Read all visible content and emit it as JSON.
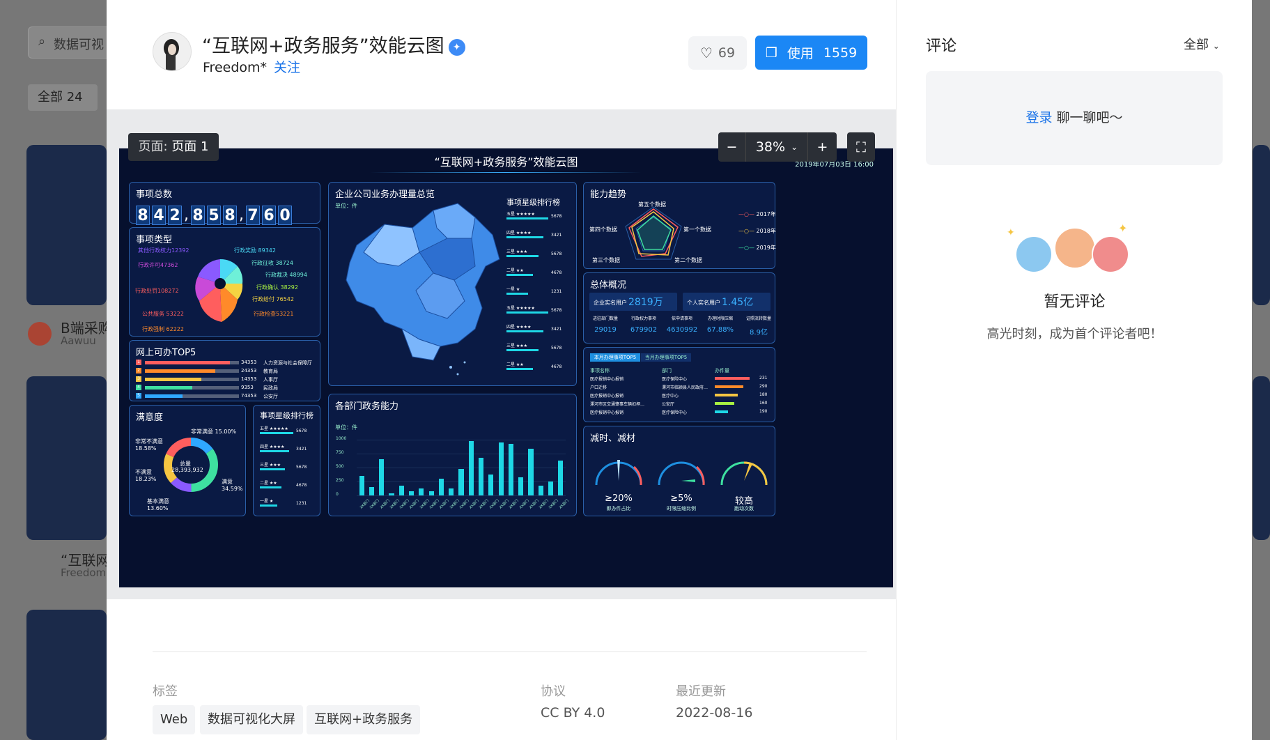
{
  "background": {
    "search_placeholder": "数据可视",
    "filter_all": "全部",
    "filter_count": "24",
    "card1_title": "B端采购",
    "card1_author": "Aawuu",
    "card2_title": "“互联网",
    "card2_author": "Freedom"
  },
  "header": {
    "title": "“互联网+政务服务”效能云图",
    "author": "Freedom*",
    "follow_label": "关注",
    "likes": "69",
    "use_label": "使用",
    "use_count": "1559"
  },
  "preview": {
    "page_prefix": "页面:",
    "page_name": "页面 1",
    "zoom_minus": "−",
    "zoom_value": "38%",
    "zoom_plus": "+"
  },
  "dashboard": {
    "title": "“互联网+政务服务”效能云图",
    "datetime": "2019年07月03日 16:00",
    "total_title": "事项总数",
    "total_digits": [
      "8",
      "4",
      "2",
      "8",
      "5",
      "8",
      "7",
      "6",
      "0"
    ],
    "types_title": "事项类型",
    "types_labels": [
      "其他行政权力12392",
      "行政许可47362",
      "行政奖励 89342",
      "行政征收 38724",
      "行政裁决 48994",
      "行政确认 38292",
      "行政给付 76542",
      "行政检查53221",
      "行政处罚108272",
      "公共服务 53222",
      "行政强制 62222"
    ],
    "top5_title": "网上可办TOP5",
    "top5_rows": [
      {
        "value": "34353",
        "name": "人力资源与社会保障厅"
      },
      {
        "value": "24353",
        "name": "教育局"
      },
      {
        "value": "14353",
        "name": "人事厅"
      },
      {
        "value": "9353",
        "name": "民政局"
      },
      {
        "value": "74353",
        "name": "公安厅"
      }
    ],
    "satisfaction_title": "满意度",
    "satisfaction_center_label": "总量",
    "satisfaction_center_value": "28,393,932",
    "satisfaction_labels": [
      "非常满意 15.00%",
      "非常不满意 18.58%",
      "不满意 18.23%",
      "满意 34.59%",
      "基本满意 13.60%"
    ],
    "star_rank_title": "事项星级排行榜",
    "star_rank_small": [
      {
        "label": "五星",
        "value": "5678"
      },
      {
        "label": "四星",
        "value": "3421"
      },
      {
        "label": "三星",
        "value": "5678"
      },
      {
        "label": "二星",
        "value": "4678"
      },
      {
        "label": "一星",
        "value": "1231"
      }
    ],
    "map_title": "企业公司业务办理量总览",
    "map_unit": "单位：件",
    "map_rank_title": "事项星级排行榜",
    "map_rank": [
      {
        "label": "五星",
        "value": "5678"
      },
      {
        "label": "四星",
        "value": "3421"
      },
      {
        "label": "三星",
        "value": "5678"
      },
      {
        "label": "二星",
        "value": "4678"
      },
      {
        "label": "一星",
        "value": "1231"
      },
      {
        "label": "五星",
        "value": "5678"
      },
      {
        "label": "四星",
        "value": "3421"
      },
      {
        "label": "三星",
        "value": "5678"
      },
      {
        "label": "二星",
        "value": "4678"
      }
    ],
    "dept_title": "各部门政务能力",
    "dept_unit": "单位：件",
    "dept_axis": [
      "1000",
      "750",
      "500",
      "250",
      "0"
    ],
    "dept_values": [
      350,
      150,
      650,
      40,
      180,
      80,
      120,
      80,
      300,
      120,
      480,
      980,
      680,
      380,
      950,
      920,
      320,
      840,
      180,
      250,
      620
    ],
    "dept_label": "XX部门",
    "radar_title": "能力趋势",
    "radar_labels": [
      "第五个数据",
      "第一个数据",
      "第二个数据",
      "第三个数据",
      "第四个数据"
    ],
    "radar_legend": [
      "2017年",
      "2018年",
      "2019年"
    ],
    "overview_title": "总体概况",
    "overview_main": [
      {
        "label": "企业实名用户",
        "value": "2819万"
      },
      {
        "label": "个人实名用户",
        "value": "1.45亿"
      }
    ],
    "overview_stats": [
      {
        "label": "进驻部门数量",
        "value": "29019"
      },
      {
        "label": "行政权力事项",
        "value": "679902"
      },
      {
        "label": "依申请事项",
        "value": "4630992"
      },
      {
        "label": "办理时限压缩",
        "value": "67.88%"
      },
      {
        "label": "证照流转数量",
        "value": "8.9亿"
      }
    ],
    "top5_tabs": [
      "本月办理事项TOP5",
      "当月办理事项TOP5"
    ],
    "top5_headers": [
      "事项名称",
      "部门",
      "办件量"
    ],
    "top5_list": [
      {
        "name": "医疗报销中心报销",
        "dept": "医疗保险中心",
        "val": "231"
      },
      {
        "name": "户口迁移",
        "dept": "漯河市临颍县人民政府…",
        "val": "290"
      },
      {
        "name": "医疗报销中心报销",
        "dept": "医疗中心",
        "val": "180"
      },
      {
        "name": "漯河市区交通肇事车辆扣押…",
        "dept": "公安厅",
        "val": "160"
      },
      {
        "name": "医疗报销中心报销",
        "dept": "医疗保险中心",
        "val": "190"
      }
    ],
    "reduce_title": "减时、减材",
    "gauges": [
      {
        "value": "≥20%",
        "label": "即办件占比"
      },
      {
        "value": "≥5%",
        "label": "时限压缩比例"
      },
      {
        "value": "较高",
        "label": "跑动次数"
      }
    ]
  },
  "footer": {
    "tags_label": "标签",
    "tags": [
      "Web",
      "数据可视化大屏",
      "互联网+政务服务"
    ],
    "license_label": "协议",
    "license_value": "CC BY 4.0",
    "updated_label": "最近更新",
    "updated_value": "2022-08-16"
  },
  "comments": {
    "title": "评论",
    "filter": "全部",
    "login_link": "登录",
    "login_text": " 聊一聊吧～",
    "empty_title": "暂无评论",
    "empty_sub": "高光时刻，成为首个评论者吧！"
  },
  "colors": {
    "accent": "#1b87f5",
    "dash_bg": "#06102e",
    "cyan": "#1ed8e6"
  }
}
